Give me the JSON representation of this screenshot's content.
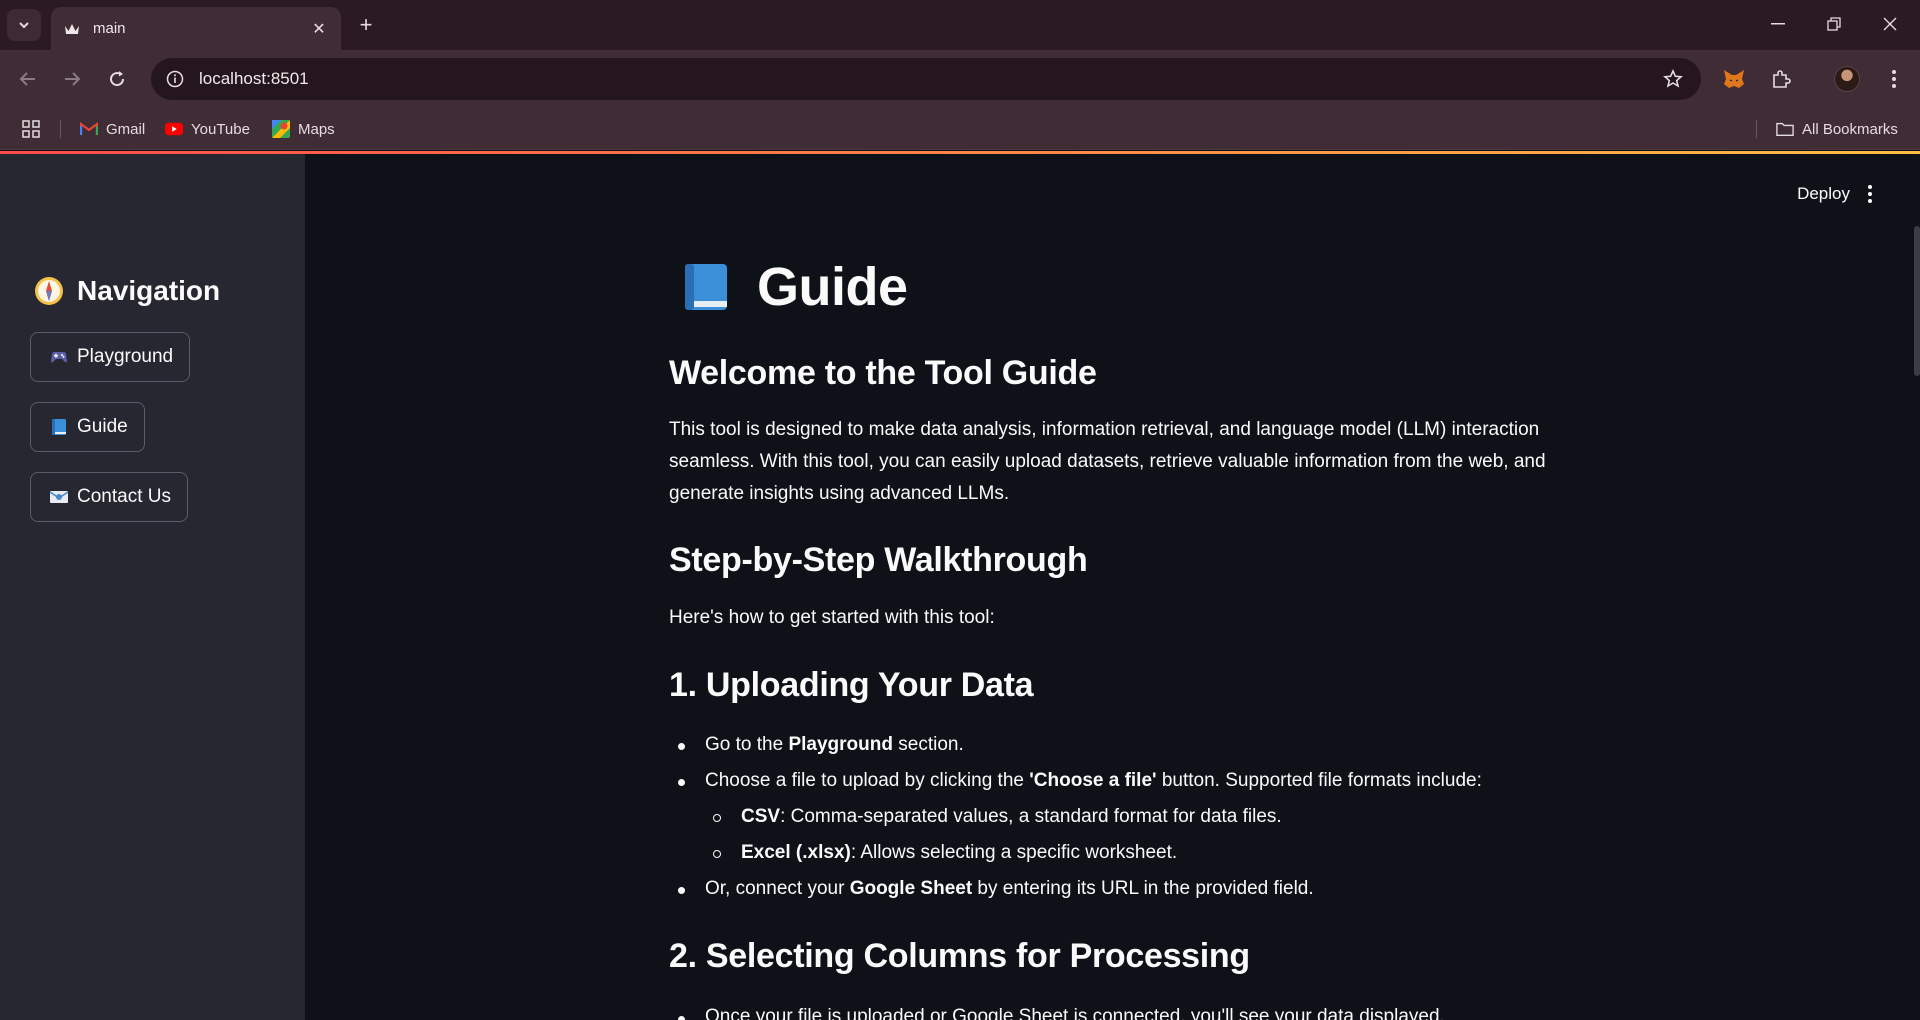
{
  "browser": {
    "tab_title": "main",
    "url": "localhost:8501",
    "bookmarks": [
      {
        "label": "Gmail",
        "icon": "gmail-icon"
      },
      {
        "label": "YouTube",
        "icon": "youtube-icon"
      },
      {
        "label": "Maps",
        "icon": "maps-icon"
      }
    ],
    "all_bookmarks_label": "All Bookmarks"
  },
  "sidebar": {
    "title": "Navigation",
    "title_icon": "compass-icon",
    "items": [
      {
        "label": "Playground",
        "icon": "game-controller-icon"
      },
      {
        "label": "Guide",
        "icon": "blue-book-icon"
      },
      {
        "label": "Contact Us",
        "icon": "envelope-icon"
      }
    ]
  },
  "header": {
    "deploy_label": "Deploy"
  },
  "page": {
    "title": "Guide",
    "title_icon": "blue-book-icon",
    "welcome_heading": "Welcome to the Tool Guide",
    "intro": "This tool is designed to make data analysis, information retrieval, and language model (LLM) interaction seamless. With this tool, you can easily upload datasets, retrieve valuable information from the web, and generate insights using advanced LLMs.",
    "walkthrough_heading": "Step-by-Step Walkthrough",
    "walkthrough_intro": "Here's how to get started with this tool:",
    "step1_heading": "1. Uploading Your Data",
    "step1": {
      "li1_pre": "Go to the ",
      "li1_bold": "Playground",
      "li1_post": " section.",
      "li2_pre": "Choose a file to upload by clicking the ",
      "li2_bold": "'Choose a file'",
      "li2_post": " button. Supported file formats include:",
      "sub1_bold": "CSV",
      "sub1_post": ": Comma-separated values, a standard format for data files.",
      "sub2_bold": "Excel (.xlsx)",
      "sub2_post": ": Allows selecting a specific worksheet.",
      "li3_pre": "Or, connect your ",
      "li3_bold": "Google Sheet",
      "li3_post": " by entering its URL in the provided field."
    },
    "step2_heading": "2. Selecting Columns for Processing",
    "step2_li1": "Once your file is uploaded or Google Sheet is connected, you'll see your data displayed."
  },
  "colors": {
    "main_bg": "#0e1117",
    "sidebar_bg": "#262730",
    "accent_gradient_start": "#ff4b4b",
    "accent_gradient_end": "#ffbd45",
    "chrome_bg": "#3f2c35"
  }
}
